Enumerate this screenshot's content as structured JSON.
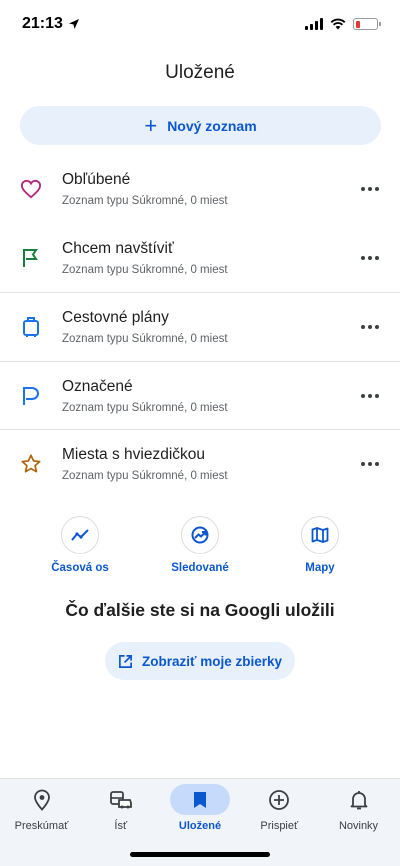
{
  "status_bar": {
    "time": "21:13",
    "battery_color": "#e53935"
  },
  "page": {
    "title": "Uložené"
  },
  "new_list": {
    "label": "Nový zoznam",
    "icon": "plus-icon"
  },
  "lists": [
    {
      "title": "Obľúbené",
      "subtitle": "Zoznam typu Súkromné, 0 miest",
      "icon": "heart-icon",
      "color": "#b3267c"
    },
    {
      "title": "Chcem navštíviť",
      "subtitle": "Zoznam typu Súkromné, 0 miest",
      "icon": "flag-icon",
      "color": "#188038"
    },
    {
      "title": "Cestovné plány",
      "subtitle": "Zoznam typu Súkromné, 0 miest",
      "icon": "suitcase-icon",
      "color": "#1a73e8"
    },
    {
      "title": "Označené",
      "subtitle": "Zoznam typu Súkromné, 0 miest",
      "icon": "label-flag-icon",
      "color": "#1a73e8"
    },
    {
      "title": "Miesta s hviezdičkou",
      "subtitle": "Zoznam typu Súkromné, 0 miest",
      "icon": "star-icon",
      "color": "#b06000"
    }
  ],
  "quick_links": [
    {
      "label": "Časová os",
      "icon": "timeline-icon"
    },
    {
      "label": "Sledované",
      "icon": "following-icon"
    },
    {
      "label": "Mapy",
      "icon": "map-icon"
    }
  ],
  "more": {
    "title": "Čo ďalšie ste si na Googli uložili",
    "button_label": "Zobraziť moje zbierky"
  },
  "nav": [
    {
      "label": "Preskúmať",
      "icon": "location-pin-icon",
      "active": false
    },
    {
      "label": "Ísť",
      "icon": "commute-icon",
      "active": false
    },
    {
      "label": "Uložené",
      "icon": "bookmark-icon",
      "active": true
    },
    {
      "label": "Prispieť",
      "icon": "add-circle-icon",
      "active": false
    },
    {
      "label": "Novinky",
      "icon": "bell-icon",
      "active": false
    }
  ],
  "colors": {
    "accent": "#0b57d0",
    "pill_bg": "#e8f0fc",
    "nav_active": "#c6dbfb"
  }
}
